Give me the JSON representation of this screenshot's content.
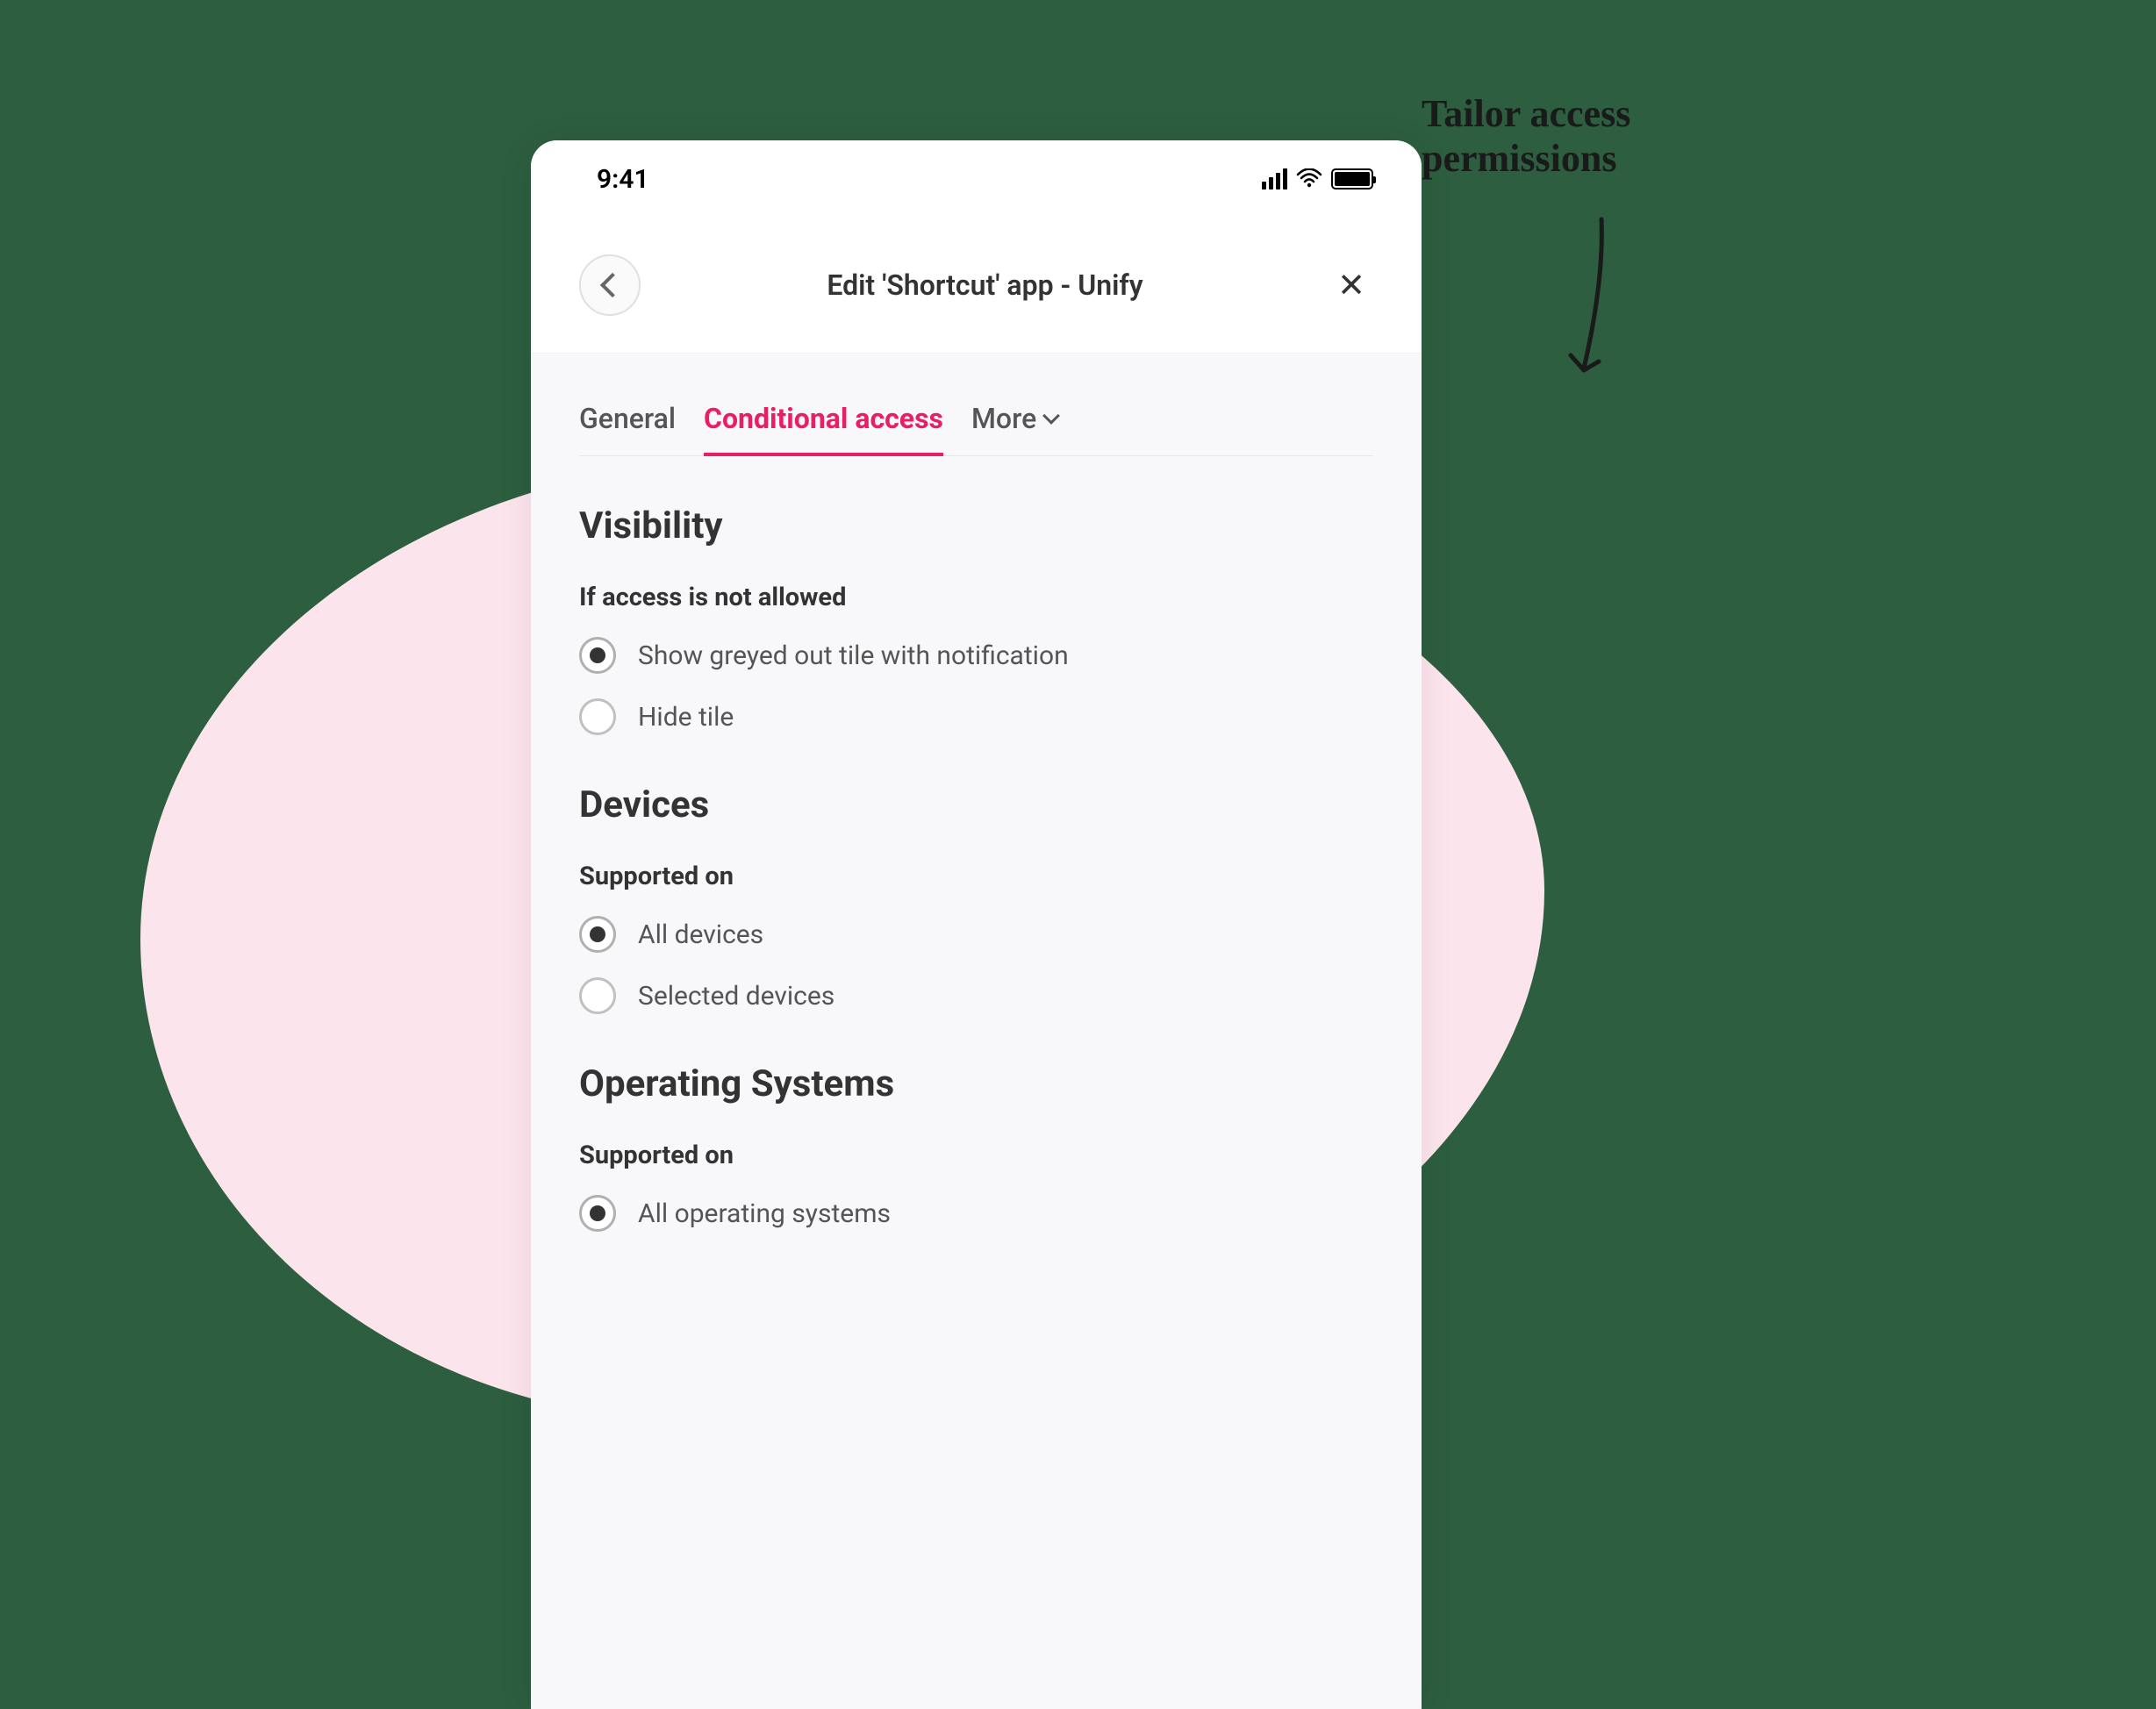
{
  "annotation": {
    "line1": "Tailor access",
    "line2": "permissions"
  },
  "statusBar": {
    "time": "9:41"
  },
  "header": {
    "title": "Edit 'Shortcut' app - Unify"
  },
  "tabs": {
    "general": "General",
    "conditional": "Conditional access",
    "more": "More"
  },
  "sections": {
    "visibility": {
      "title": "Visibility",
      "subLabel": "If access is not allowed",
      "options": {
        "greyed": "Show greyed out tile with notification",
        "hide": "Hide tile"
      }
    },
    "devices": {
      "title": "Devices",
      "subLabel": "Supported on",
      "options": {
        "all": "All devices",
        "selected": "Selected devices"
      }
    },
    "os": {
      "title": "Operating Systems",
      "subLabel": "Supported on",
      "options": {
        "all": "All operating systems"
      }
    }
  }
}
